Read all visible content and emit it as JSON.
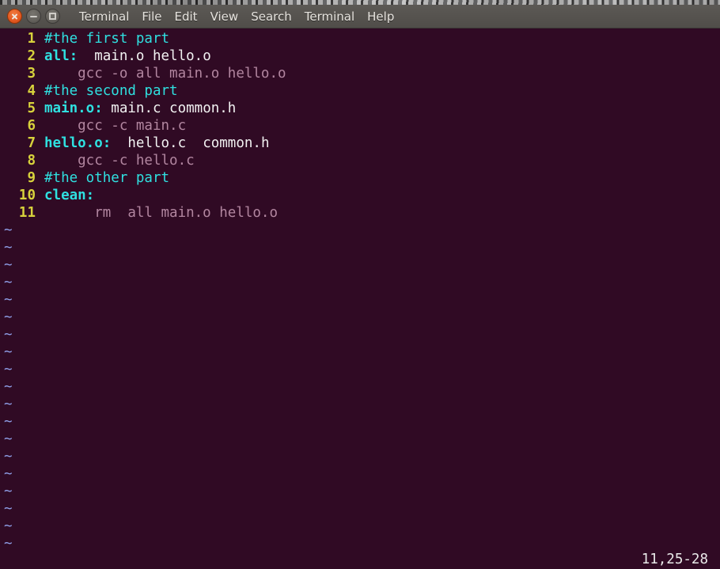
{
  "window": {
    "title": "Terminal",
    "buttons": [
      {
        "name": "close",
        "label": "Close"
      },
      {
        "name": "minimize",
        "label": "Minimize"
      },
      {
        "name": "maximize",
        "label": "Maximize"
      }
    ]
  },
  "menubar": {
    "items": [
      {
        "label": "Terminal"
      },
      {
        "label": "File"
      },
      {
        "label": "Edit"
      },
      {
        "label": "View"
      },
      {
        "label": "Search"
      },
      {
        "label": "Terminal"
      },
      {
        "label": "Help"
      }
    ]
  },
  "editor": {
    "colors": {
      "background": "#300a24",
      "line_number": "#d8d23c",
      "comment": "#2fe0e0",
      "target": "#2fe0e0",
      "dependency": "#f2f2f2",
      "command": "#b286a0",
      "tilde": "#8f9fe8"
    },
    "lines": [
      {
        "num": "1",
        "segments": [
          {
            "text": "#the first part",
            "style": "comment"
          }
        ]
      },
      {
        "num": "2",
        "segments": [
          {
            "text": "all:",
            "style": "target"
          },
          {
            "text": "  main.o hello.o",
            "style": "dep"
          }
        ]
      },
      {
        "num": "3",
        "segments": [
          {
            "text": "    gcc -o all main.o hello.o",
            "style": "cmd"
          }
        ]
      },
      {
        "num": "4",
        "segments": [
          {
            "text": "#the second part",
            "style": "comment"
          }
        ]
      },
      {
        "num": "5",
        "segments": [
          {
            "text": "main.o:",
            "style": "target"
          },
          {
            "text": " main.c common.h",
            "style": "dep"
          }
        ]
      },
      {
        "num": "6",
        "segments": [
          {
            "text": "    gcc -c main.c",
            "style": "cmd"
          }
        ]
      },
      {
        "num": "7",
        "segments": [
          {
            "text": "hello.o:",
            "style": "target"
          },
          {
            "text": "  hello.c  common.h",
            "style": "dep"
          }
        ]
      },
      {
        "num": "8",
        "segments": [
          {
            "text": "    gcc -c hello.c",
            "style": "cmd"
          }
        ]
      },
      {
        "num": "9",
        "segments": [
          {
            "text": "#the other part",
            "style": "comment"
          }
        ]
      },
      {
        "num": "10",
        "segments": [
          {
            "text": "clean:",
            "style": "target"
          }
        ]
      },
      {
        "num": "11",
        "segments": [
          {
            "text": "      rm  all main.o hello.o",
            "style": "cmd"
          }
        ]
      }
    ],
    "empty_marker": "~",
    "empty_marker_count": 19,
    "status": "11,25-28"
  }
}
